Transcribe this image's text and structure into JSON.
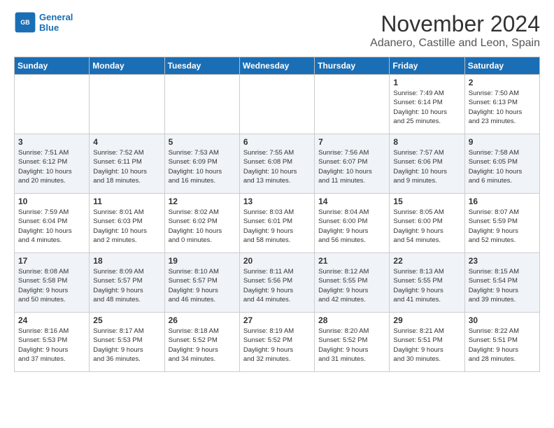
{
  "logo": {
    "line1": "General",
    "line2": "Blue"
  },
  "title": "November 2024",
  "location": "Adanero, Castille and Leon, Spain",
  "days_of_week": [
    "Sunday",
    "Monday",
    "Tuesday",
    "Wednesday",
    "Thursday",
    "Friday",
    "Saturday"
  ],
  "weeks": [
    [
      {
        "day": "",
        "info": ""
      },
      {
        "day": "",
        "info": ""
      },
      {
        "day": "",
        "info": ""
      },
      {
        "day": "",
        "info": ""
      },
      {
        "day": "",
        "info": ""
      },
      {
        "day": "1",
        "info": "Sunrise: 7:49 AM\nSunset: 6:14 PM\nDaylight: 10 hours\nand 25 minutes."
      },
      {
        "day": "2",
        "info": "Sunrise: 7:50 AM\nSunset: 6:13 PM\nDaylight: 10 hours\nand 23 minutes."
      }
    ],
    [
      {
        "day": "3",
        "info": "Sunrise: 7:51 AM\nSunset: 6:12 PM\nDaylight: 10 hours\nand 20 minutes."
      },
      {
        "day": "4",
        "info": "Sunrise: 7:52 AM\nSunset: 6:11 PM\nDaylight: 10 hours\nand 18 minutes."
      },
      {
        "day": "5",
        "info": "Sunrise: 7:53 AM\nSunset: 6:09 PM\nDaylight: 10 hours\nand 16 minutes."
      },
      {
        "day": "6",
        "info": "Sunrise: 7:55 AM\nSunset: 6:08 PM\nDaylight: 10 hours\nand 13 minutes."
      },
      {
        "day": "7",
        "info": "Sunrise: 7:56 AM\nSunset: 6:07 PM\nDaylight: 10 hours\nand 11 minutes."
      },
      {
        "day": "8",
        "info": "Sunrise: 7:57 AM\nSunset: 6:06 PM\nDaylight: 10 hours\nand 9 minutes."
      },
      {
        "day": "9",
        "info": "Sunrise: 7:58 AM\nSunset: 6:05 PM\nDaylight: 10 hours\nand 6 minutes."
      }
    ],
    [
      {
        "day": "10",
        "info": "Sunrise: 7:59 AM\nSunset: 6:04 PM\nDaylight: 10 hours\nand 4 minutes."
      },
      {
        "day": "11",
        "info": "Sunrise: 8:01 AM\nSunset: 6:03 PM\nDaylight: 10 hours\nand 2 minutes."
      },
      {
        "day": "12",
        "info": "Sunrise: 8:02 AM\nSunset: 6:02 PM\nDaylight: 10 hours\nand 0 minutes."
      },
      {
        "day": "13",
        "info": "Sunrise: 8:03 AM\nSunset: 6:01 PM\nDaylight: 9 hours\nand 58 minutes."
      },
      {
        "day": "14",
        "info": "Sunrise: 8:04 AM\nSunset: 6:00 PM\nDaylight: 9 hours\nand 56 minutes."
      },
      {
        "day": "15",
        "info": "Sunrise: 8:05 AM\nSunset: 6:00 PM\nDaylight: 9 hours\nand 54 minutes."
      },
      {
        "day": "16",
        "info": "Sunrise: 8:07 AM\nSunset: 5:59 PM\nDaylight: 9 hours\nand 52 minutes."
      }
    ],
    [
      {
        "day": "17",
        "info": "Sunrise: 8:08 AM\nSunset: 5:58 PM\nDaylight: 9 hours\nand 50 minutes."
      },
      {
        "day": "18",
        "info": "Sunrise: 8:09 AM\nSunset: 5:57 PM\nDaylight: 9 hours\nand 48 minutes."
      },
      {
        "day": "19",
        "info": "Sunrise: 8:10 AM\nSunset: 5:57 PM\nDaylight: 9 hours\nand 46 minutes."
      },
      {
        "day": "20",
        "info": "Sunrise: 8:11 AM\nSunset: 5:56 PM\nDaylight: 9 hours\nand 44 minutes."
      },
      {
        "day": "21",
        "info": "Sunrise: 8:12 AM\nSunset: 5:55 PM\nDaylight: 9 hours\nand 42 minutes."
      },
      {
        "day": "22",
        "info": "Sunrise: 8:13 AM\nSunset: 5:55 PM\nDaylight: 9 hours\nand 41 minutes."
      },
      {
        "day": "23",
        "info": "Sunrise: 8:15 AM\nSunset: 5:54 PM\nDaylight: 9 hours\nand 39 minutes."
      }
    ],
    [
      {
        "day": "24",
        "info": "Sunrise: 8:16 AM\nSunset: 5:53 PM\nDaylight: 9 hours\nand 37 minutes."
      },
      {
        "day": "25",
        "info": "Sunrise: 8:17 AM\nSunset: 5:53 PM\nDaylight: 9 hours\nand 36 minutes."
      },
      {
        "day": "26",
        "info": "Sunrise: 8:18 AM\nSunset: 5:52 PM\nDaylight: 9 hours\nand 34 minutes."
      },
      {
        "day": "27",
        "info": "Sunrise: 8:19 AM\nSunset: 5:52 PM\nDaylight: 9 hours\nand 32 minutes."
      },
      {
        "day": "28",
        "info": "Sunrise: 8:20 AM\nSunset: 5:52 PM\nDaylight: 9 hours\nand 31 minutes."
      },
      {
        "day": "29",
        "info": "Sunrise: 8:21 AM\nSunset: 5:51 PM\nDaylight: 9 hours\nand 30 minutes."
      },
      {
        "day": "30",
        "info": "Sunrise: 8:22 AM\nSunset: 5:51 PM\nDaylight: 9 hours\nand 28 minutes."
      }
    ]
  ]
}
